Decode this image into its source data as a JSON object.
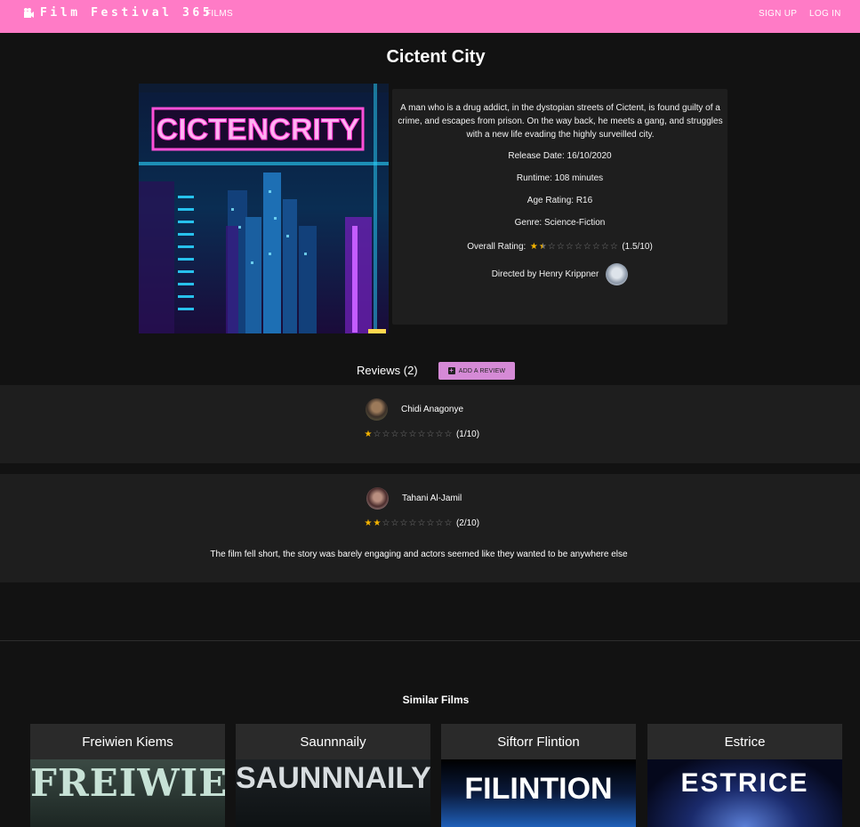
{
  "nav": {
    "brand": "Film Festival 365",
    "films": "FILMS",
    "signup": "SIGN UP",
    "login": "LOG IN"
  },
  "film": {
    "title": "Cictent City",
    "poster_text": "CICTENCRITY",
    "synopsis": "A man who is a drug addict, in the dystopian streets of Cictent, is found guilty of a crime, and escapes from prison. On the way back, he meets a gang, and struggles with a new life evading the highly surveilled city.",
    "release": "Release Date: 16/10/2020",
    "runtime": "Runtime: 108 minutes",
    "age_rating": "Age Rating: R16",
    "genre": "Genre: Science-Fiction",
    "rating_label": "Overall Rating:",
    "rating_value": 1.5,
    "rating_text": "(1.5/10)",
    "director": "Directed by Henry Krippner"
  },
  "reviews": {
    "label": "Reviews",
    "count": "(2)",
    "add_label": "ADD A REVIEW",
    "items": [
      {
        "name": "Chidi Anagonye",
        "rating": 1,
        "rating_text": "(1/10)",
        "text": ""
      },
      {
        "name": "Tahani Al-Jamil",
        "rating": 2,
        "rating_text": "(2/10)",
        "text": "The film fell short, the story was barely engaging and actors seemed like they wanted to be anywhere else"
      }
    ]
  },
  "similar": {
    "title": "Similar Films",
    "films": [
      {
        "name": "Freiwien Kiems",
        "poster_text": "FREIWIEN"
      },
      {
        "name": "Saunnnaily",
        "poster_text": "SAUNNNAILY"
      },
      {
        "name": "Siftorr Flintion",
        "poster_text": "FILINTION"
      },
      {
        "name": "Estrice",
        "poster_text": "ESTRICE"
      }
    ]
  },
  "colors": {
    "navbar": "#ff7bc6",
    "background": "#121212",
    "panel": "#1e1e1e",
    "star": "#f5b400",
    "add_button": "#d58ad6"
  }
}
